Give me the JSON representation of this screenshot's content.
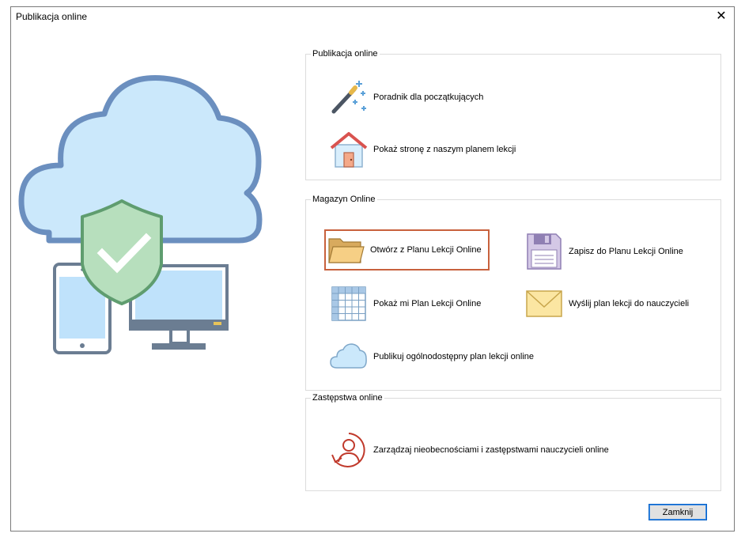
{
  "window": {
    "title": "Publikacja online"
  },
  "groups": {
    "publikacja": {
      "legend": "Publikacja online",
      "items": [
        {
          "label": "Poradnik dla początkujących",
          "icon": "magic-wand-icon"
        },
        {
          "label": "Pokaż stronę z naszym planem lekcji",
          "icon": "house-icon"
        }
      ]
    },
    "magazyn": {
      "legend": "Magazyn Online",
      "items": [
        {
          "label": "Otwórz z Planu Lekcji Online",
          "icon": "folder-icon"
        },
        {
          "label": "Zapisz do Planu Lekcji Online",
          "icon": "floppy-icon"
        },
        {
          "label": "Pokaż mi Plan Lekcji Online",
          "icon": "table-icon"
        },
        {
          "label": "Wyślij plan lekcji do nauczycieli",
          "icon": "envelope-icon"
        },
        {
          "label": "Publikuj ogólnodostępny plan lekcji online",
          "icon": "cloud-icon"
        }
      ]
    },
    "zastepstwa": {
      "legend": "Zastępstwa online",
      "items": [
        {
          "label": "Zarządzaj nieobecnościami i zastępstwami nauczycieli online",
          "icon": "person-refresh-icon"
        }
      ]
    }
  },
  "buttons": {
    "close_label": "Zamknij"
  },
  "colors": {
    "accent_selection": "#c8613d",
    "cloud_fill": "#cbe8fb",
    "cloud_stroke": "#6b8fbf",
    "shield_fill": "#b7dfbd",
    "shield_stroke": "#5f9d6f"
  }
}
